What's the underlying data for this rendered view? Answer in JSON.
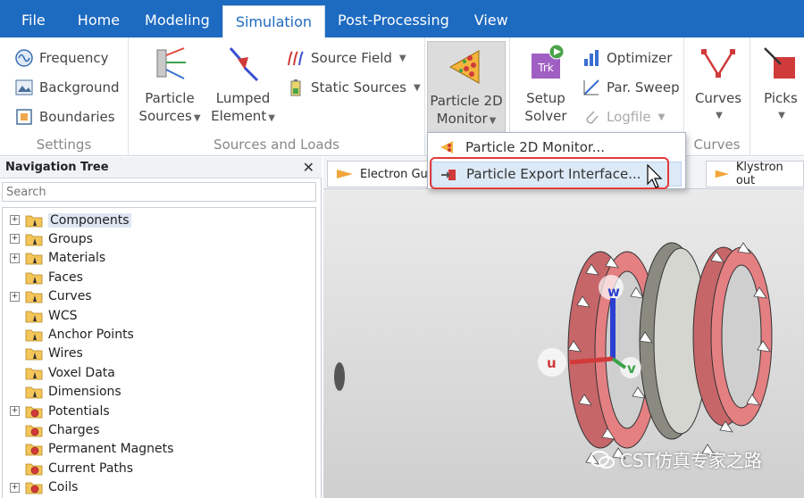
{
  "menu": {
    "tabs": [
      "File",
      "Home",
      "Modeling",
      "Simulation",
      "Post-Processing",
      "View"
    ],
    "active": "Simulation"
  },
  "ribbon": {
    "settings": {
      "label": "Settings",
      "frequency": "Frequency",
      "background": "Background",
      "boundaries": "Boundaries"
    },
    "sources": {
      "label": "Sources and Loads",
      "particle_sources": [
        "Particle",
        "Sources"
      ],
      "lumped_element": [
        "Lumped",
        "Element"
      ],
      "source_field": "Source Field",
      "static_sources": "Static Sources"
    },
    "particle_monitor": [
      "Particle 2D",
      "Monitor"
    ],
    "solver": {
      "setup_solver": [
        "Setup",
        "Solver"
      ],
      "optimizer": "Optimizer",
      "par_sweep": "Par. Sweep",
      "logfile": "Logfile",
      "trk_icon_text": "Trk"
    },
    "curves": {
      "button": "Curves",
      "label": "Curves"
    },
    "picks": "Picks"
  },
  "dropdown": {
    "items": [
      "Particle 2D Monitor...",
      "Particle Export Interface..."
    ]
  },
  "nav": {
    "title": "Navigation Tree",
    "search_placeholder": "Search",
    "items": [
      {
        "label": "Components",
        "expandable": true,
        "selected": true,
        "icon": "folder-icon"
      },
      {
        "label": "Groups",
        "expandable": true,
        "icon": "folder-icon"
      },
      {
        "label": "Materials",
        "expandable": true,
        "icon": "folder-icon"
      },
      {
        "label": "Faces",
        "expandable": false,
        "icon": "folder-icon"
      },
      {
        "label": "Curves",
        "expandable": true,
        "icon": "folder-icon"
      },
      {
        "label": "WCS",
        "expandable": false,
        "icon": "folder-icon"
      },
      {
        "label": "Anchor Points",
        "expandable": false,
        "icon": "folder-icon"
      },
      {
        "label": "Wires",
        "expandable": false,
        "icon": "folder-icon"
      },
      {
        "label": "Voxel Data",
        "expandable": false,
        "icon": "folder-icon"
      },
      {
        "label": "Dimensions",
        "expandable": false,
        "icon": "folder-icon"
      },
      {
        "label": "Potentials",
        "expandable": true,
        "icon": "folder-gear-icon"
      },
      {
        "label": "Charges",
        "expandable": false,
        "icon": "folder-gear-icon"
      },
      {
        "label": "Permanent Magnets",
        "expandable": false,
        "icon": "folder-gear-icon"
      },
      {
        "label": "Current Paths",
        "expandable": false,
        "icon": "folder-gear-icon"
      },
      {
        "label": "Coils",
        "expandable": true,
        "icon": "folder-gear-icon"
      }
    ]
  },
  "viewport": {
    "tabs": [
      "Electron Gun",
      "Klystron out"
    ],
    "axes": {
      "u": "u",
      "v": "v",
      "w": "w"
    }
  },
  "watermark": "CST仿真专家之路",
  "colors": {
    "menubar": "#1d6ac1",
    "highlight": "#e23a3a",
    "ring": "#e47f82",
    "selection": "#dde6f1"
  }
}
